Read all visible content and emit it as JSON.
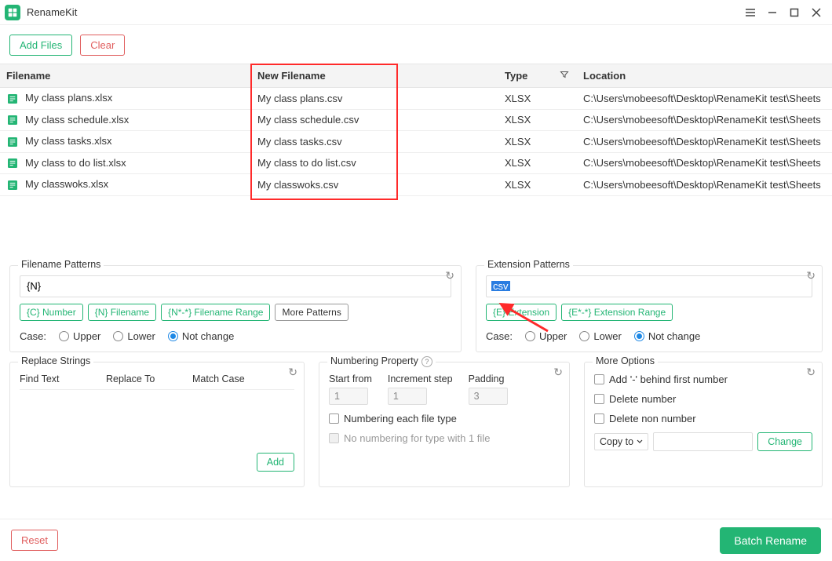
{
  "app": {
    "title": "RenameKit"
  },
  "toolbar": {
    "add_files": "Add Files",
    "clear": "Clear"
  },
  "table": {
    "columns": {
      "filename": "Filename",
      "new_filename": "New Filename",
      "type": "Type",
      "location": "Location"
    },
    "rows": [
      {
        "filename": "My class plans.xlsx",
        "new": "My class plans.csv",
        "type": "XLSX",
        "location": "C:\\Users\\mobeesoft\\Desktop\\RenameKit test\\Sheets"
      },
      {
        "filename": "My class schedule.xlsx",
        "new": "My class schedule.csv",
        "type": "XLSX",
        "location": "C:\\Users\\mobeesoft\\Desktop\\RenameKit test\\Sheets"
      },
      {
        "filename": "My class tasks.xlsx",
        "new": "My class tasks.csv",
        "type": "XLSX",
        "location": "C:\\Users\\mobeesoft\\Desktop\\RenameKit test\\Sheets"
      },
      {
        "filename": "My class to do list.xlsx",
        "new": "My class to do list.csv",
        "type": "XLSX",
        "location": "C:\\Users\\mobeesoft\\Desktop\\RenameKit test\\Sheets"
      },
      {
        "filename": "My classwoks.xlsx",
        "new": "My classwoks.csv",
        "type": "XLSX",
        "location": "C:\\Users\\mobeesoft\\Desktop\\RenameKit test\\Sheets"
      }
    ]
  },
  "filename_patterns": {
    "title": "Filename Patterns",
    "value": "{N}",
    "tags": {
      "c_number": "{C} Number",
      "n_filename": "{N} Filename",
      "range": "{N*-*} Filename Range",
      "more": "More Patterns"
    },
    "case_label": "Case:",
    "upper": "Upper",
    "lower": "Lower",
    "not_change": "Not change"
  },
  "extension_patterns": {
    "title": "Extension Patterns",
    "value": "csv",
    "tags": {
      "e_ext": "{E} Extension",
      "range": "{E*-*} Extension Range"
    },
    "case_label": "Case:",
    "upper": "Upper",
    "lower": "Lower",
    "not_change": "Not change"
  },
  "replace_strings": {
    "title": "Replace Strings",
    "cols": {
      "find": "Find Text",
      "replace": "Replace To",
      "match": "Match Case"
    },
    "add": "Add"
  },
  "numbering": {
    "title": "Numbering Property",
    "start_label": "Start from",
    "start_value": "1",
    "step_label": "Increment step",
    "step_value": "1",
    "pad_label": "Padding",
    "pad_value": "3",
    "each_type": "Numbering each file type",
    "no_num_1file": "No numbering for type with 1 file"
  },
  "more_options": {
    "title": "More Options",
    "dash_first": "Add '-' behind first number",
    "del_number": "Delete number",
    "del_non_number": "Delete non number",
    "copy_to": "Copy to",
    "change": "Change"
  },
  "footer": {
    "reset": "Reset",
    "batch_rename": "Batch Rename"
  }
}
